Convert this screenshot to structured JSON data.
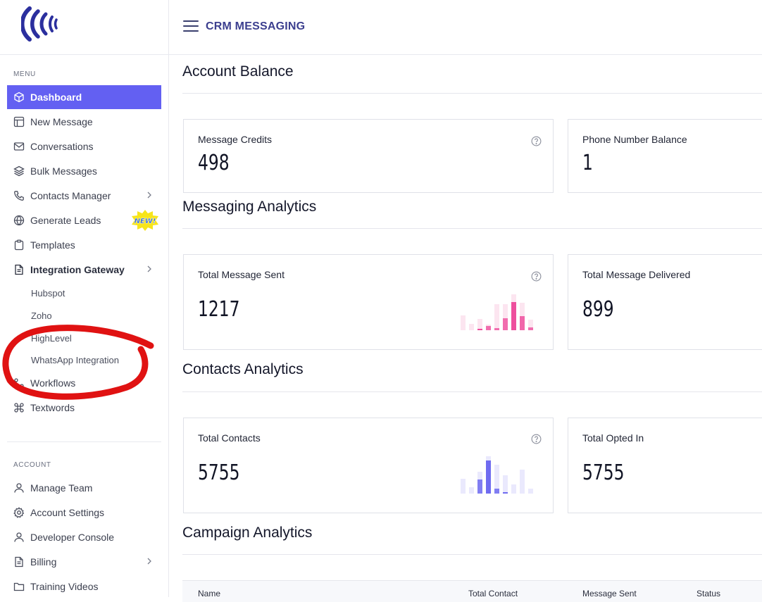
{
  "header": {
    "title": "CRM MESSAGING"
  },
  "sidebar": {
    "menu_label": "MENU",
    "account_label": "ACCOUNT",
    "new_badge": "NEW!",
    "items": [
      {
        "label": "Dashboard",
        "icon": "cube-icon"
      },
      {
        "label": "New Message",
        "icon": "layout-icon"
      },
      {
        "label": "Conversations",
        "icon": "mail-icon"
      },
      {
        "label": "Bulk Messages",
        "icon": "layers-icon"
      },
      {
        "label": "Contacts Manager",
        "icon": "phone-icon"
      },
      {
        "label": "Generate Leads",
        "icon": "globe-icon"
      },
      {
        "label": "Templates",
        "icon": "clipboard-icon"
      },
      {
        "label": "Integration Gateway",
        "icon": "file-text-icon"
      },
      {
        "label": "Workflows",
        "icon": "workflow-icon"
      },
      {
        "label": "Textwords",
        "icon": "command-icon"
      }
    ],
    "sub_items": [
      "Hubspot",
      "Zoho",
      "HighLevel",
      "WhatsApp Integration"
    ],
    "account_items": [
      {
        "label": "Manage Team",
        "icon": "user-icon"
      },
      {
        "label": "Account Settings",
        "icon": "settings-icon"
      },
      {
        "label": "Developer Console",
        "icon": "user-icon"
      },
      {
        "label": "Billing",
        "icon": "file-text-icon"
      },
      {
        "label": "Training Videos",
        "icon": "folder-icon"
      }
    ]
  },
  "main": {
    "account_balance": {
      "title": "Account Balance",
      "cards": [
        {
          "label": "Message Credits",
          "value": "498"
        },
        {
          "label": "Phone Number Balance",
          "value": "1"
        }
      ]
    },
    "messaging_analytics": {
      "title": "Messaging Analytics",
      "cards": [
        {
          "label": "Total Message Sent",
          "value": "1217"
        },
        {
          "label": "Total Message Delivered",
          "value": "899"
        }
      ]
    },
    "contacts_analytics": {
      "title": "Contacts Analytics",
      "cards": [
        {
          "label": "Total Contacts",
          "value": "5755"
        },
        {
          "label": "Total Opted In",
          "value": "5755"
        }
      ]
    },
    "campaign_analytics": {
      "title": "Campaign Analytics",
      "columns": [
        "Name",
        "Total Contact",
        "Message Sent",
        "Status"
      ]
    }
  },
  "colors": {
    "accent": "#6360f2",
    "brand_logo": "#2b2f9e",
    "spark_pink": "#ee4f9d",
    "spark_purple": "#6f6bf0",
    "annotation_red": "#e01212"
  }
}
